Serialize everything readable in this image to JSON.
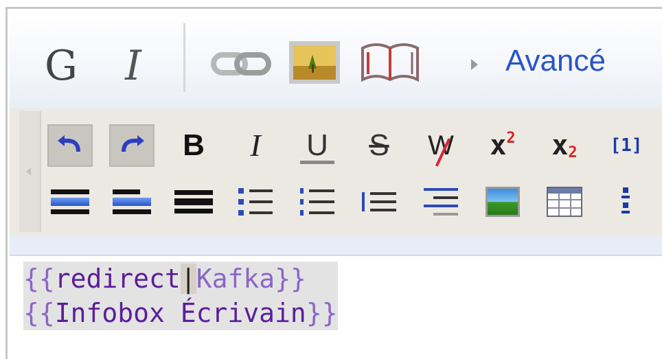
{
  "toolbar1": {
    "bold_label": "G",
    "italic_label": "I",
    "link_icon": "link-icon",
    "image_icon": "image-icon",
    "book_icon": "book-icon",
    "advanced_label": "Avancé"
  },
  "toolbar2": {
    "row1": {
      "undo_icon": "undo-icon",
      "redo_icon": "redo-icon",
      "bold_label": "B",
      "italic_label": "I",
      "underline_label": "U",
      "strike_label": "S",
      "nowiki_label": "W",
      "superscript_label": "x",
      "superscript_num": "2",
      "subscript_label": "x",
      "subscript_num": "2",
      "reference_label": "[1]"
    },
    "row2": {
      "icons": [
        "heading-blue-icon",
        "heading-link-icon",
        "horizontal-rule-icon",
        "bulleted-list-icon",
        "numbered-list-icon",
        "indent-icon",
        "definition-list-icon",
        "gallery-icon",
        "table-icon",
        "reference-list-icon"
      ]
    }
  },
  "editor": {
    "line1": {
      "open": "{{",
      "name": "redirect",
      "pipe": "|",
      "param": "Kafka",
      "close": "}}"
    },
    "line2": {
      "open": "{{",
      "name": "Infobox Écrivain",
      "close": "}}"
    }
  },
  "colors": {
    "advanced_link": "#2a55c8",
    "toolbar2_bg": "#ece9e3",
    "template_brace": "#8a66c8",
    "template_name": "#5a1e9a"
  }
}
